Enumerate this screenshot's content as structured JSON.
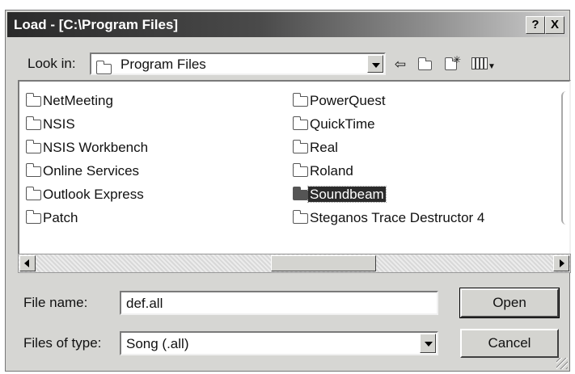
{
  "dialog": {
    "title": "Load - [C:\\Program Files]",
    "help_label": "?",
    "close_label": "X"
  },
  "look_in": {
    "label": "Look in:",
    "value": "Program Files",
    "icons": [
      "back-arrow-icon",
      "up-folder-icon",
      "new-folder-icon",
      "view-menu-icon"
    ]
  },
  "files": {
    "column1": [
      "NetMeeting",
      "NSIS",
      "NSIS Workbench",
      "Online Services",
      "Outlook Express",
      "Patch"
    ],
    "column2": [
      "PowerQuest",
      "QuickTime",
      "Real",
      "Roland",
      "Soundbeam",
      "Steganos Trace Destructor 4"
    ],
    "selected": "Soundbeam"
  },
  "file_name": {
    "label": "File name:",
    "value": "def.all"
  },
  "file_type": {
    "label": "Files of type:",
    "value": "Song (.all)"
  },
  "buttons": {
    "open": "Open",
    "cancel": "Cancel"
  }
}
